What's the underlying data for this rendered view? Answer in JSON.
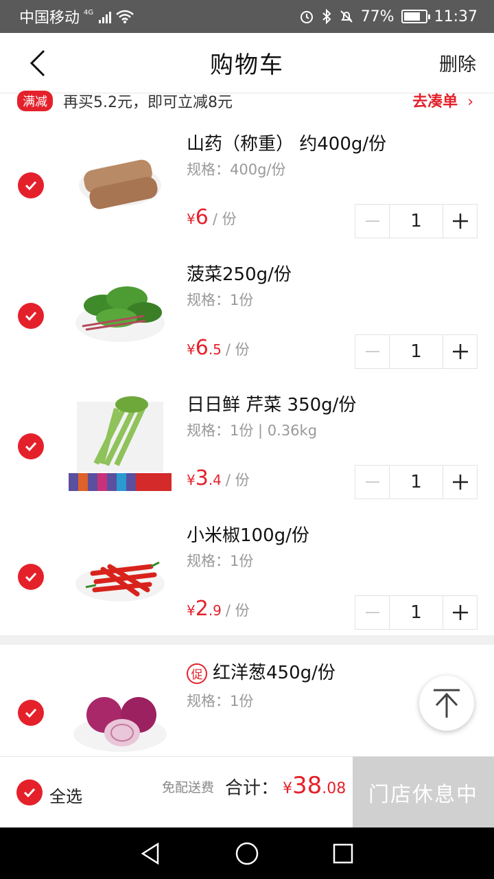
{
  "status_bar": {
    "carrier": "中国移动",
    "network": "4G",
    "battery": "77%",
    "time": "11:37"
  },
  "header": {
    "title": "购物车",
    "delete_label": "删除"
  },
  "promo": {
    "badge": "满减",
    "text": "再买5.2元，即可立减8元",
    "link_label": "去凑单"
  },
  "items": [
    {
      "name": "山药（称重） 约400g/份",
      "spec": "规格：400g/份",
      "price_int": "6",
      "price_dec": "",
      "unit": "/ 份",
      "qty": "1",
      "checked": true,
      "image": "yam"
    },
    {
      "name": "菠菜250g/份",
      "spec": "规格：1份",
      "price_int": "6",
      "price_dec": ".5",
      "unit": "/ 份",
      "qty": "1",
      "checked": true,
      "image": "spinach"
    },
    {
      "name": "日日鲜 芹菜 350g/份",
      "spec": "规格：1份 | 0.36kg",
      "price_int": "3",
      "price_dec": ".4",
      "unit": "/ 份",
      "qty": "1",
      "checked": true,
      "image": "celery"
    },
    {
      "name": "小米椒100g/份",
      "spec": "规格：1份",
      "price_int": "2",
      "price_dec": ".9",
      "unit": "/ 份",
      "qty": "1",
      "checked": true,
      "image": "chili"
    },
    {
      "promo_icon": "促",
      "name": "红洋葱450g/份",
      "spec": "规格：1份",
      "checked": true,
      "image": "onion"
    }
  ],
  "currency": "¥",
  "bottom": {
    "select_all": "全选",
    "shipping": "免配送费",
    "total_label": "合计：",
    "total_int": "38",
    "total_dec": ".08",
    "checkout_label": "门店休息中"
  },
  "colors": {
    "accent": "#e4212b",
    "disabled": "#d0d0d0"
  }
}
